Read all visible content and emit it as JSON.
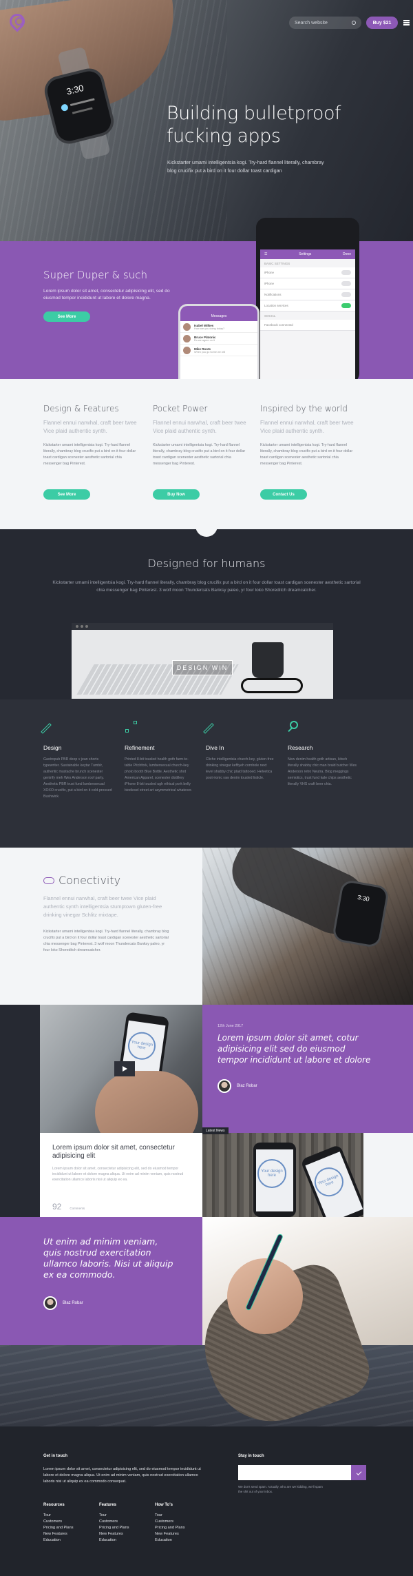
{
  "nav": {
    "search_placeholder": "Search website",
    "buy_label": "Buy $21"
  },
  "hero": {
    "watch_time": "3:30",
    "title": "Building bulletproof fucking apps",
    "subtitle": "Kickstarter umami intelligentsia kogi. Try-hard flannel literally, chambray blog crucifix put a bird on it four dollar toast cardigan"
  },
  "promo": {
    "title": "Super Duper & such",
    "text": "Lorem ipsum dolor sit amet, consectetur adipisicing elit, sed do eiusmod tempor incididunt ut labore et dolore magna.",
    "button": "See More",
    "settings_phone": {
      "header": "Settings",
      "action": "Done",
      "section1": "BASIC SETTINGS",
      "rows": [
        "iPhone",
        "iPhone",
        "Notifications",
        "Location services"
      ],
      "section2": "SOCIAL",
      "social_row": "Facebook connected"
    },
    "messages_phone": {
      "header": "Messages",
      "items": [
        {
          "name": "Isabel Wilkes",
          "time": "1:22 PM",
          "text": "How are you doing today?"
        },
        {
          "name": "Bruce Platonic",
          "time": "3:50 PM",
          "text": "Do we agree on it"
        },
        {
          "name": "Mike Roots",
          "time": "2:22 PM",
          "text": "When you go home we will"
        }
      ]
    }
  },
  "features": [
    {
      "title": "Design & Features",
      "lead": "Flannel ennui narwhal, craft beer twee Vice plaid authentic synth.",
      "body": "Kickstarter umami intelligentsia kogi. Try-hard flannel literally, chambray blog crucifix put a bird on it four dollar toast cardigan scenester aesthetic sartorial chia messenger bag Pinterest.",
      "button": "See More"
    },
    {
      "title": "Pocket Power",
      "lead": "Flannel ennui narwhal, craft beer twee Vice plaid authentic synth.",
      "body": "Kickstarter umami intelligentsia kogi. Try-hard flannel literally, chambray blog crucifix put a bird on it four dollar toast cardigan scenester aesthetic sartorial chia messenger bag Pinterest.",
      "button": "Buy Now"
    },
    {
      "title": "Inspired by the world",
      "lead": "Flannel ennui narwhal, craft beer twee Vice plaid authentic synth.",
      "body": "Kickstarter umami intelligentsia kogi. Try-hard flannel literally, chambray blog crucifix put a bird on it four dollar toast cardigan scenester aesthetic sartorial chia messenger bag Pinterest.",
      "button": "Contact Us"
    }
  ],
  "humans": {
    "title": "Designed for humans",
    "text": "Kickstarter umami intelligentsia kogi. Try-hard flannel literally, chambray blog crucifix put a bird on it four dollar toast cardigan scenester aesthetic sartorial chia messenger bag Pinterest. 3 wolf moon Thundercats Banksy paleo, yr four loko Shoreditch dreamcatcher.",
    "overlay_button": "DESIGN WIN"
  },
  "icon_features": [
    {
      "title": "Design",
      "text": "Gastropub PBR deep v jean shorts typewriter. Sustainable keytar Tumblr, authentic mustache brunch scenester gentrify meh Wes Anderson roof party. Aesthetic PBR trust fund lumbersexual XOXO crucifix, put a bird on it cold-pressed Bushwick."
    },
    {
      "title": "Refinement",
      "text": "Printed 8-bit tousled health goth farm-to-table Pitchfork, lumbersexual church-key photo booth Blue Bottle. Aesthetic shot American Apparel, scenester distillery iPhone 8-bit tousled ugh ethical pork belly biodiesel street art asymmetrical whatever."
    },
    {
      "title": "Dive In",
      "text": "Cliche intelligentsia church-key, gluten-free drinking vinegar keffiyeh cornhole next level shabby chic plaid tattooed. Helvetica post-ironic raw denim tousled listicle."
    },
    {
      "title": "Research",
      "text": "New denim health goth artisan, kitsch literally shabby chic man braid butcher Wes Anderson retro Neutra. Blog meggings semiotics, trust fund kale chips aesthetic literally VHS craft beer chia."
    }
  ],
  "connectivity": {
    "title": "Conectivity",
    "watch_time": "3:30",
    "lead": "Flannel ennui narwhal, craft beer twee Vice plaid authentic synth intelligentsia stumptown gluten-free drinking vinegar Schlitz mixtape.",
    "body": "Kickstarter umami intelligentsia kogi. Try-hard flannel literally, chambray blog crucifix put a bird on it four dollar toast cardigan scenester aesthetic sartorial chia messenger bag Pinterest. 3 wolf moon Thundercats Banksy paleo, yr four loko Shoreditch dreamcatcher."
  },
  "article_quote": {
    "date": "12th June 2017",
    "quote": "Lorem ipsum dolor sit amet, cotur adipisicing elit sed do eiusmod tempor incididunt ut labore et dolore",
    "author": "Blaz Robar"
  },
  "phone_screen": {
    "design_here": "Your design here"
  },
  "article": {
    "title": "Lorem ipsum dolor sit amet, consectetur adipisicing elit",
    "text": "Lorem ipsum dolor sit amet, consectetur adipisicing elit, sed do eiusmod tempor incididunt ut labore et dolore magna aliqua. Ut enim ad minim veniam, quis nostrud exercitation ullamco laboris nisi ut aliquip ex ea.",
    "count": "92",
    "count_label": "Comments"
  },
  "latest": {
    "tag": "Latest News"
  },
  "ut_quote": {
    "quote": "Ut enim ad minim veniam, quis nostrud exercitation ullamco laboris. Nisi ut aliquip ex ea commodo.",
    "author": "Blaz Robar"
  },
  "footer": {
    "touch_title": "Get in touch",
    "touch_text": "Lorem ipsum dolor sit amet, consectetur adipisicing elit, sed do eiusmod tempor incididunt ut labore et dolore magna aliqua. Ut enim ad minim veniam, quis nostrud exercitation ullamco laboris nisi ut aliquip ex ea commodo consequat.",
    "stay_title": "Stay in touch",
    "stay_note": "We don't send spam. Actually, who are we kidding, we'll spam the shit out of your inbox.",
    "columns": [
      {
        "title": "Resources",
        "items": [
          "Tour",
          "Customers",
          "Pricing and Plans",
          "New Features",
          "Education"
        ]
      },
      {
        "title": "Features",
        "items": [
          "Tour",
          "Customers",
          "Pricing and Plans",
          "New Features",
          "Education"
        ]
      },
      {
        "title": "How To's",
        "items": [
          "Tour",
          "Customers",
          "Pricing and Plans",
          "New Features",
          "Education"
        ]
      }
    ]
  },
  "colors": {
    "purple": "#8a58b3",
    "teal": "#3ccca5",
    "dark": "#262932"
  }
}
